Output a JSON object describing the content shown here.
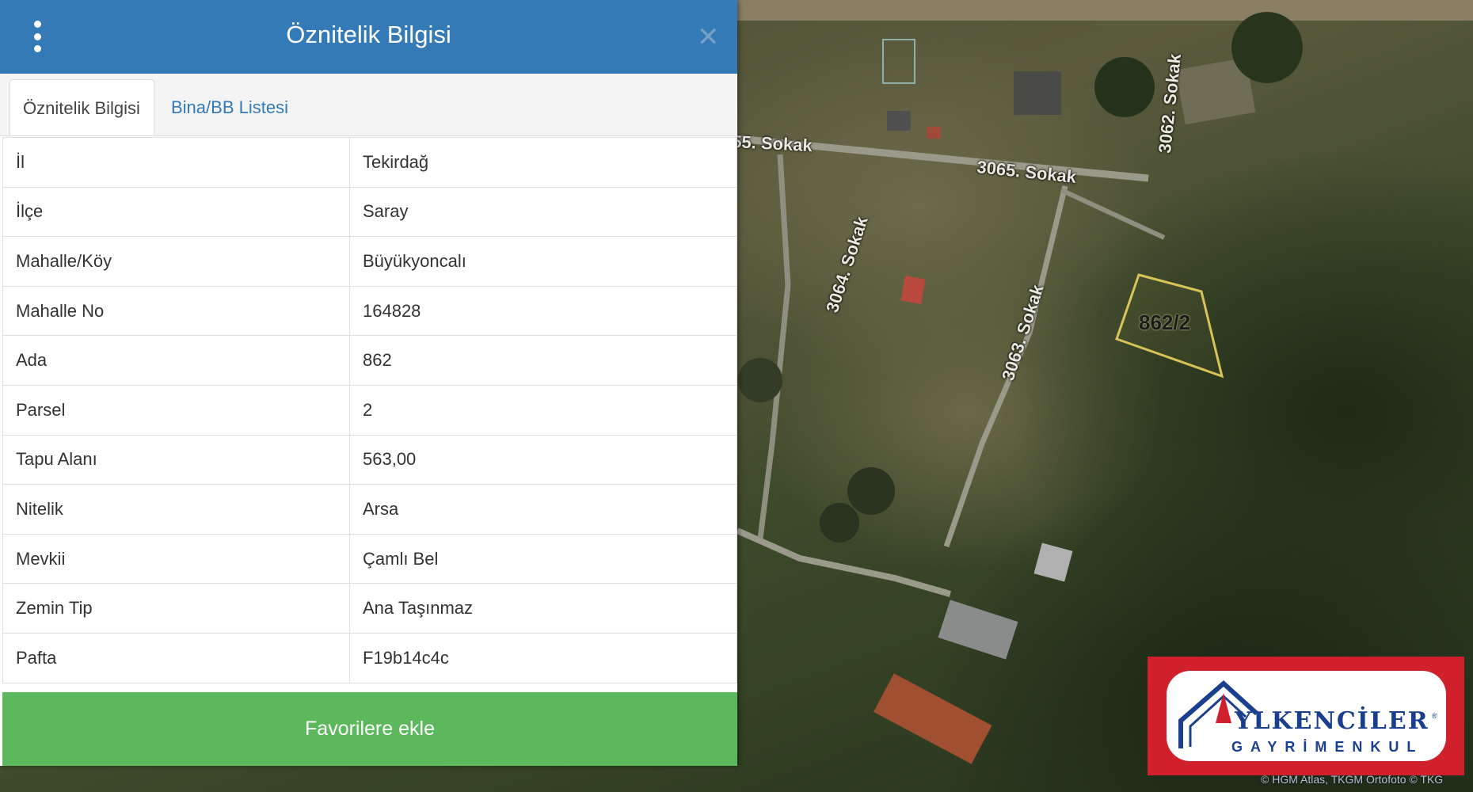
{
  "panel": {
    "title": "Öznitelik Bilgisi",
    "tabs": [
      {
        "label": "Öznitelik Bilgisi",
        "active": true
      },
      {
        "label": "Bina/BB Listesi",
        "active": false
      }
    ],
    "rows": [
      {
        "key": "İl",
        "value": "Tekirdağ"
      },
      {
        "key": "İlçe",
        "value": "Saray"
      },
      {
        "key": "Mahalle/Köy",
        "value": "Büyükyoncalı"
      },
      {
        "key": "Mahalle No",
        "value": "164828"
      },
      {
        "key": "Ada",
        "value": "862"
      },
      {
        "key": "Parsel",
        "value": "2"
      },
      {
        "key": "Tapu Alanı",
        "value": "563,00"
      },
      {
        "key": "Nitelik",
        "value": "Arsa"
      },
      {
        "key": "Mevkii",
        "value": "Çamlı Bel"
      },
      {
        "key": "Zemin Tip",
        "value": "Ana Taşınmaz"
      },
      {
        "key": "Pafta",
        "value": "F19b14c4c"
      }
    ],
    "favorite_button": "Favorilere ekle"
  },
  "map": {
    "street_labels": [
      "55. Sokak",
      "3065. Sokak",
      "3062. Sokak",
      "3064. Sokak",
      "3063. Sokak"
    ],
    "parcel_label": "862/2",
    "attribution": "© HGM Atlas, TKGM Ortofoto © TKG"
  },
  "logo": {
    "title": "YLKENCİLER",
    "subtitle": "GAYRİMENKUL",
    "registered": "®"
  },
  "colors": {
    "header": "#337ab7",
    "button": "#5cb85c",
    "logo_red": "#d0202c",
    "logo_blue": "#1a3f8f",
    "parcel_outline": "#d8c25a"
  }
}
